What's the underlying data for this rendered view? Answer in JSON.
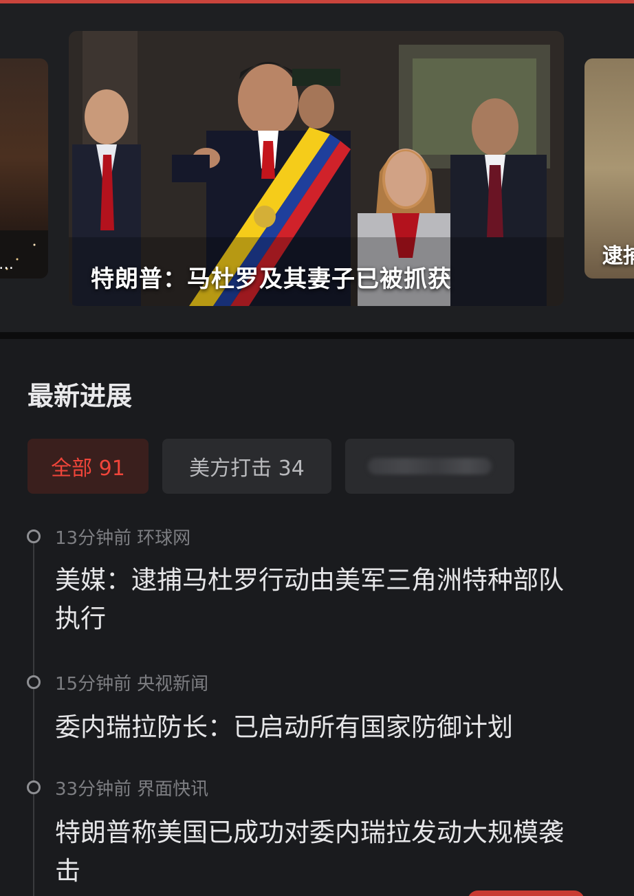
{
  "carousel": {
    "left_slide": {
      "caption": "…"
    },
    "main_slide": {
      "caption": "特朗普：马杜罗及其妻子已被抓获"
    },
    "right_slide": {
      "caption": "逮捕"
    }
  },
  "latest": {
    "title": "最新进展",
    "tabs": [
      {
        "label": "全部 91",
        "active": true
      },
      {
        "label": "美方打击 34",
        "active": false
      },
      {
        "label": "",
        "blurred": true
      }
    ],
    "items": [
      {
        "time": "13分钟前",
        "source": "环球网",
        "headline": "美媒：逮捕马杜罗行动由美军三角洲特种部队执行"
      },
      {
        "time": "15分钟前",
        "source": "央视新闻",
        "headline": "委内瑞拉防长：已启动所有国家防御计划"
      },
      {
        "time": "33分钟前",
        "source": "界面快讯",
        "headline": "特朗普称美国已成功对委内瑞拉发动大规模袭击"
      }
    ]
  },
  "colors": {
    "accent": "#f0453a",
    "active_tab_bg": "#3a1f1d",
    "background": "#1a1b1e"
  }
}
